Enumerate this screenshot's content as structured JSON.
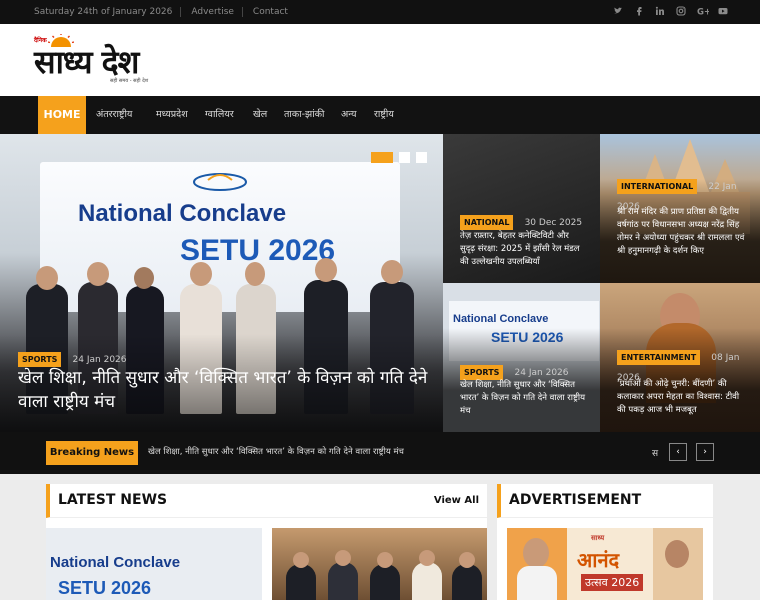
{
  "topbar": {
    "date": "Saturday 24th of January 2026",
    "links": [
      "Advertise",
      "Contact"
    ],
    "social": [
      "twitter-icon",
      "facebook-icon",
      "linkedin-icon",
      "instagram-icon",
      "google-plus-icon",
      "youtube-icon"
    ]
  },
  "logo": {
    "small": "दैनिक",
    "title": "साध्य देश",
    "tagline": "सही समय - सही देश"
  },
  "nav": {
    "items": [
      "HOME",
      "अंतरराष्ट्रीय",
      "मध्यप्रदेश",
      "ग्वालियर",
      "खेल",
      "ताका-झांकी",
      "अन्य",
      "राष्ट्रीय"
    ]
  },
  "hero": {
    "image_text": [
      "National Conclave",
      "SETU 2026"
    ],
    "category": "SPORTS",
    "date": "24 Jan 2026",
    "headline": "खेल शिक्षा, नीति सुधार और ‘विक्सित भारत’ के विज़न को गति देने वाला राष्ट्रीय मंच"
  },
  "tiles": [
    {
      "category": "NATIONAL",
      "date": "30 Dec 2025",
      "text": "तेज़ रफ़्तार, बेहतर कनेक्टिविटी और सुदृढ़ संरक्षा: 2025 में झाँसी रेल मंडल की उल्लेखनीय उपलब्धियाँ"
    },
    {
      "category": "INTERNATIONAL",
      "date": "22 Jan 2026",
      "text": "श्री राम मंदिर की प्राण प्रतिष्ठा की द्वितीय वर्षगांठ पर विधानसभा अध्यक्ष नरेंद्र सिंह तोमर ने अयोध्या पहुंचकर श्री रामलला एवं श्री हनुमानगढ़ी के दर्शन किए"
    },
    {
      "category": "SPORTS",
      "date": "24 Jan 2026",
      "text": "खेल शिक्षा, नीति सुधार और ‘विक्सित भारत’ के विज़न को गति देने वाला राष्ट्रीय मंच"
    },
    {
      "category": "ENTERTAINMENT",
      "date": "08 Jan 2026",
      "text": "‘प्रथाओं की ओढ़े चुनरी: बींदणी’ की कलाकार अपरा मेहता का विश्वास: टीवी की पकड़ आज भी मजबूत"
    }
  ],
  "breaking": {
    "label": "Breaking News",
    "ticker": "खेल शिक्षा, नीति सुधार और ‘विक्सित भारत’ के विज़न को गति देने वाला राष्ट्रीय मंच",
    "more": "स",
    "prev": "‹",
    "next": "›"
  },
  "latest": {
    "title": "LATEST NEWS",
    "view_all": "View All"
  },
  "advert": {
    "title": "ADVERTISEMENT",
    "brand": "साध्य",
    "headline": "आनंद",
    "sub": "उत्सव 2026"
  },
  "colors": {
    "accent": "#f5a11c",
    "dark": "#111111"
  }
}
